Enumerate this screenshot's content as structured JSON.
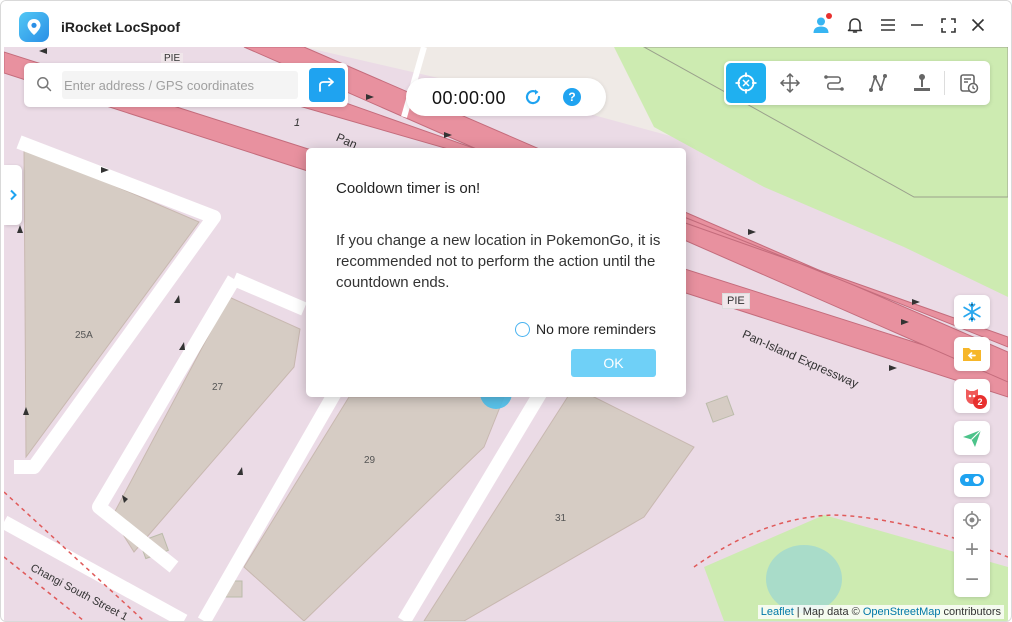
{
  "app": {
    "title": "iRocket LocSpoof",
    "notification_dot_color": "#e8302e",
    "brand_color": "#1fa3f0"
  },
  "titlebar_icons": [
    "user-icon",
    "bell-icon",
    "menu-icon",
    "minimize-icon",
    "fullscreen-icon",
    "close-icon"
  ],
  "search": {
    "placeholder": "Enter address / GPS coordinates",
    "value": ""
  },
  "timer": {
    "value": "00:00:00",
    "help_label": "?"
  },
  "mode_toolbar": {
    "items": [
      "teleport-mode-icon",
      "joystick-mode-icon",
      "two-spot-mode-icon",
      "multi-spot-mode-icon",
      "jump-teleport-icon",
      "history-icon"
    ],
    "active": "teleport-mode-icon"
  },
  "side_buttons": {
    "items": [
      "snowflake-icon",
      "folder-import-icon",
      "pokemon-icon",
      "send-icon",
      "toggle-icon"
    ],
    "pokemon_badge": "2"
  },
  "zoom": {
    "plus": "+",
    "minus": "−"
  },
  "map_labels": {
    "pie_top": "PIE",
    "pan_top": "Pan",
    "road_number": "1",
    "pie_right": "PIE",
    "expressway": "Pan-Island Expressway",
    "street": "Changi South Street 1",
    "lot_25a": "25A",
    "lot_27": "27",
    "lot_29": "29",
    "lot_31": "31"
  },
  "attribution": {
    "leaflet": "Leaflet",
    "separator": " | Map data © ",
    "osm": "OpenStreetMap",
    "suffix": " contributors"
  },
  "dialog": {
    "title": "Cooldown timer is on!",
    "message": "If you change a new location in PokemonGo, it is recommended not to perform the action until the countdown ends.",
    "remind_label": "No more reminders",
    "ok_label": "OK"
  }
}
